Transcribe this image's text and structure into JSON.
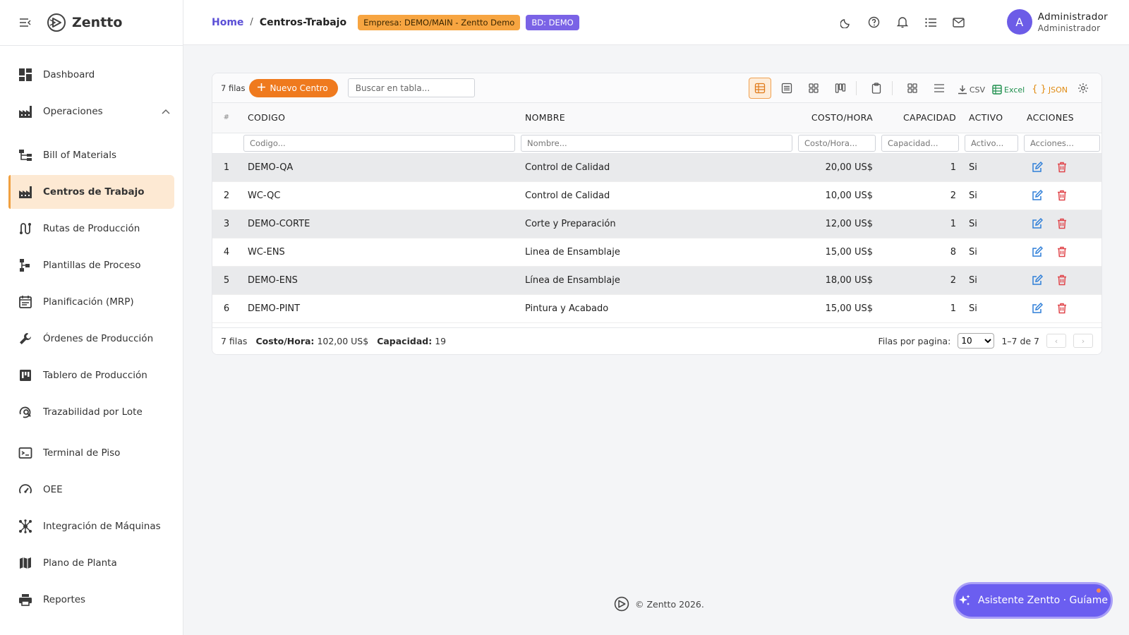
{
  "app": {
    "brand": "Zentto",
    "copyright": "© Zentto 2026."
  },
  "sidebar": {
    "items": [
      {
        "label": "Dashboard",
        "icon": "dashboard-icon"
      },
      {
        "label": "Operaciones",
        "icon": "factory-icon",
        "expanded": true
      },
      {
        "label": "Bill of Materials",
        "icon": "tree-icon"
      },
      {
        "label": "Centros de Trabajo",
        "icon": "factory-icon",
        "active": true
      },
      {
        "label": "Rutas de Producción",
        "icon": "route-icon"
      },
      {
        "label": "Plantillas de Proceso",
        "icon": "process-icon"
      },
      {
        "label": "Planificación (MRP)",
        "icon": "calendar-icon"
      },
      {
        "label": "Órdenes de Producción",
        "icon": "wrench-icon"
      },
      {
        "label": "Tablero de Producción",
        "icon": "kanban-icon"
      },
      {
        "label": "Trazabilidad por Lote",
        "icon": "search-doc-icon"
      },
      {
        "label": "Terminal de Piso",
        "icon": "terminal-icon"
      },
      {
        "label": "OEE",
        "icon": "gauge-icon"
      },
      {
        "label": "Integración de Máquinas",
        "icon": "hub-icon"
      },
      {
        "label": "Plano de Planta",
        "icon": "map-icon"
      },
      {
        "label": "Reportes",
        "icon": "printer-icon"
      }
    ]
  },
  "header": {
    "breadcrumb_home": "Home",
    "breadcrumb_sep": "/",
    "breadcrumb_current": "Centros-Trabajo",
    "badge_empresa": "Empresa: DEMO/MAIN - Zentto Demo",
    "badge_bd": "BD: DEMO",
    "user_initial": "A",
    "user_name": "Administrador",
    "user_role": "Administrador"
  },
  "toolbar": {
    "rows_count": "7 filas",
    "new_button": "Nuevo Centro",
    "search_placeholder": "Buscar en tabla...",
    "csv_label": "CSV",
    "excel_label": "Excel",
    "json_label": "JSON"
  },
  "table": {
    "headers": {
      "idx": "#",
      "codigo": "CODIGO",
      "nombre": "NOMBRE",
      "costo": "COSTO/HORA",
      "capacidad": "CAPACIDAD",
      "activo": "ACTIVO",
      "acciones": "ACCIONES"
    },
    "filters": {
      "codigo": "Codigo...",
      "nombre": "Nombre...",
      "costo": "Costo/Hora...",
      "capacidad": "Capacidad...",
      "activo": "Activo...",
      "acciones": "Acciones..."
    },
    "rows": [
      {
        "idx": "1",
        "codigo": "DEMO-QA",
        "nombre": "Control de Calidad",
        "costo": "20,00 US$",
        "capacidad": "1",
        "activo": "Si"
      },
      {
        "idx": "2",
        "codigo": "WC-QC",
        "nombre": "Control de Calidad",
        "costo": "10,00 US$",
        "capacidad": "2",
        "activo": "Si"
      },
      {
        "idx": "3",
        "codigo": "DEMO-CORTE",
        "nombre": "Corte y Preparación",
        "costo": "12,00 US$",
        "capacidad": "1",
        "activo": "Si"
      },
      {
        "idx": "4",
        "codigo": "WC-ENS",
        "nombre": "Linea de Ensamblaje",
        "costo": "15,00 US$",
        "capacidad": "8",
        "activo": "Si"
      },
      {
        "idx": "5",
        "codigo": "DEMO-ENS",
        "nombre": "Línea de Ensamblaje",
        "costo": "18,00 US$",
        "capacidad": "2",
        "activo": "Si"
      },
      {
        "idx": "6",
        "codigo": "DEMO-PINT",
        "nombre": "Pintura y Acabado",
        "costo": "15,00 US$",
        "capacidad": "1",
        "activo": "Si"
      }
    ]
  },
  "footer": {
    "rows": "7 filas",
    "costo_label": "Costo/Hora:",
    "costo_value": "102,00 US$",
    "capacidad_label": "Capacidad:",
    "capacidad_value": "19",
    "per_page_label": "Filas por pagina:",
    "per_page_value": "10",
    "range": "1–7 de 7",
    "prev": "‹",
    "next": "›"
  },
  "assistant": {
    "label": "Asistente Zentto · Guíame"
  },
  "colors": {
    "accent": "#ef7a1e",
    "primary": "#6b5ef0",
    "active_bg": "#fde9d3",
    "edit": "#2f7fd8",
    "delete": "#e0454a"
  }
}
